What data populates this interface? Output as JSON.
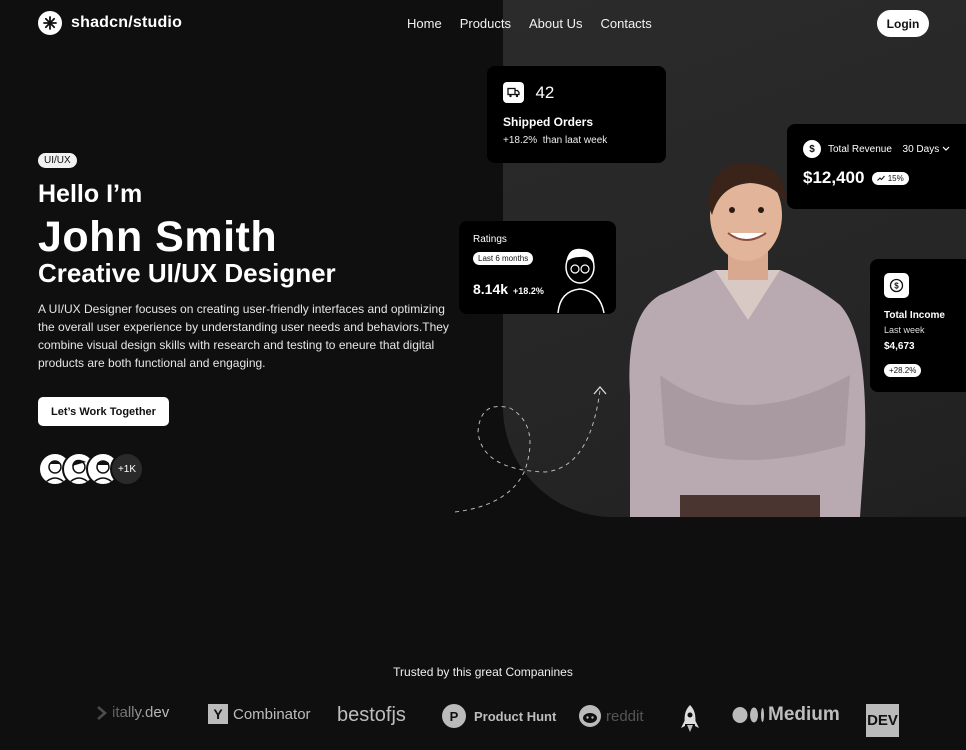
{
  "brand": {
    "name": "shadcn/studio"
  },
  "nav": {
    "items": [
      "Home",
      "Products",
      "About Us",
      "Contacts"
    ],
    "login": "Login"
  },
  "hero": {
    "badge": "UI/UX",
    "greeting": "Hello I’m",
    "name": "John Smith",
    "role": "Creative UI/UX Designer",
    "description": "A UI/UX Designer focuses on creating user-friendly interfaces and optimizing the overall user experience by understanding user needs and behaviors.They combine visual design skills with research and testing to eneure that digital products are both functional and engaging.",
    "cta": "Let’s Work Together",
    "avatars_more": "+1K"
  },
  "cards": {
    "shipped": {
      "value": "42",
      "title": "Shipped Orders",
      "change": "+18.2%",
      "change_text": "than laat week"
    },
    "revenue": {
      "title": "Total Revenue",
      "range": "30 Days",
      "value": "$12,400",
      "change": "15%"
    },
    "ratings": {
      "title": "Ratings",
      "period": "Last 6 months",
      "value": "8.14k",
      "change": "+18.2%"
    },
    "income": {
      "title": "Total Income",
      "period": "Last week",
      "value": "$4,673",
      "change": "+28.2%"
    }
  },
  "trusted": {
    "title": "Trusted by this great Companines",
    "logos": [
      "itally.dev",
      "Combinator",
      "bestofjs",
      "Product Hunt",
      "reddit",
      "Medium",
      "DEV"
    ]
  },
  "icons": {
    "logo": "asterisk-icon",
    "shipped": "truck-icon",
    "revenue": "dollar-icon",
    "income": "dollar-circle-icon",
    "trend": "trend-up-icon",
    "range": "chevron-down-icon"
  }
}
